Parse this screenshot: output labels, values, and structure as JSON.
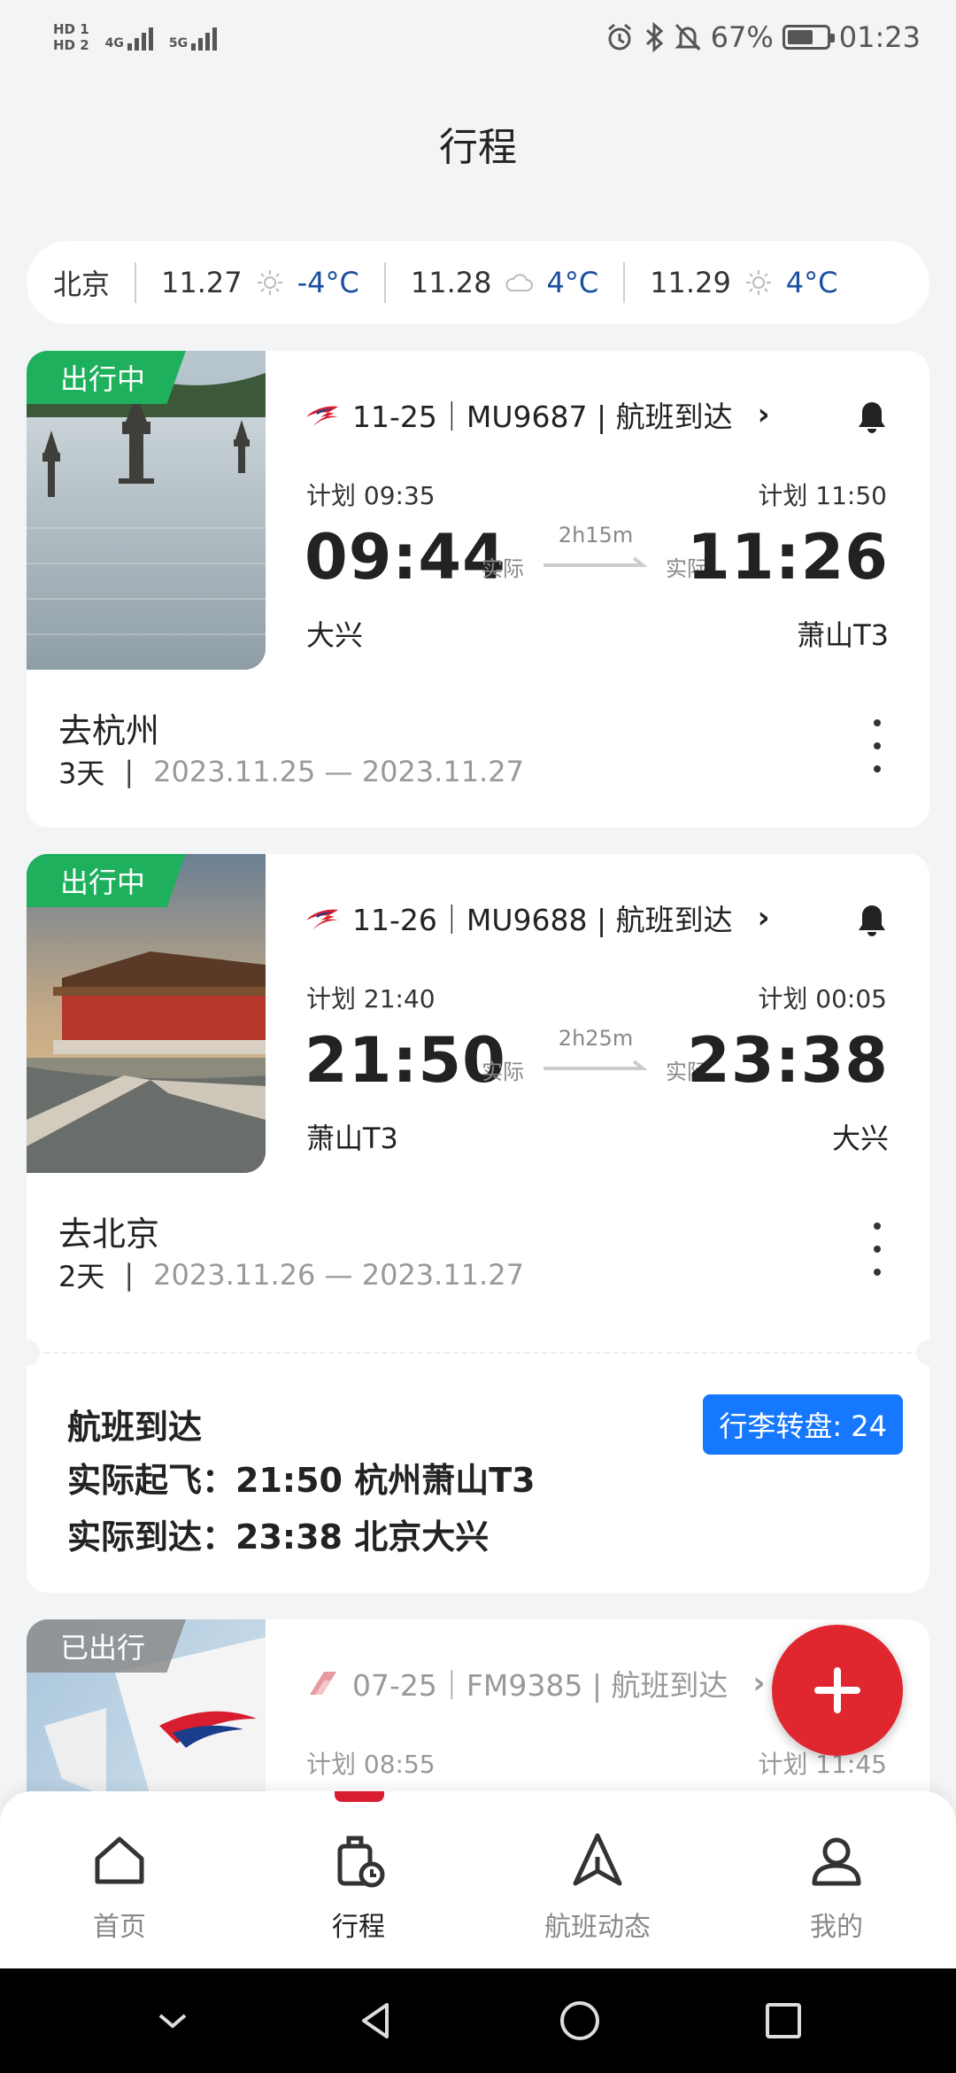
{
  "status": {
    "hd1": "HD 1",
    "hd2": "HD 2",
    "net1": "4G",
    "net2": "5G",
    "battery_pct": "67%",
    "battery_level": 0.67,
    "time": "01:23"
  },
  "page_title": "行程",
  "weather": {
    "city": "北京",
    "days": [
      {
        "date": "11.27",
        "icon": "sun-icon",
        "temp": "-4°C"
      },
      {
        "date": "11.28",
        "icon": "cloud-icon",
        "temp": "4°C"
      },
      {
        "date": "11.29",
        "icon": "sun-icon",
        "temp": "4°C"
      }
    ]
  },
  "trips": [
    {
      "badge": "出行中",
      "flight_line": "11-25｜MU9687 | 航班到达",
      "plan_dep": "计划 09:35",
      "plan_arr": "计划 11:50",
      "dep_time": "09:44",
      "arr_time": "11:26",
      "actual_label": "实际",
      "duration": "2h15m",
      "dep_airport": "大兴",
      "arr_airport": "萧山T3",
      "trip_name": "去杭州",
      "trip_days": "3天",
      "trip_sep": "|",
      "trip_dates": "2023.11.25 — 2023.11.27"
    },
    {
      "badge": "出行中",
      "flight_line": "11-26｜MU9688 | 航班到达",
      "plan_dep": "计划 21:40",
      "plan_arr": "计划 00:05",
      "dep_time": "21:50",
      "arr_time": "23:38",
      "actual_label": "实际",
      "duration": "2h25m",
      "dep_airport": "萧山T3",
      "arr_airport": "大兴",
      "trip_name": "去北京",
      "trip_days": "2天",
      "trip_sep": "|",
      "trip_dates": "2023.11.26 — 2023.11.27",
      "arrival": {
        "title": "航班到达",
        "dep_line": "实际起飞：21:50 杭州萧山T3",
        "arr_line": "实际到达：23:38 北京大兴",
        "baggage": "行李转盘: 24"
      }
    },
    {
      "badge": "已出行",
      "flight_line": "07-25｜FM9385 | 航班到达",
      "plan_dep": "计划 08:55",
      "plan_arr": "计划 11:45"
    }
  ],
  "tabs": [
    {
      "label": "首页",
      "icon": "home-icon"
    },
    {
      "label": "行程",
      "icon": "luggage-icon"
    },
    {
      "label": "航班动态",
      "icon": "plane-icon"
    },
    {
      "label": "我的",
      "icon": "user-icon"
    }
  ],
  "colors": {
    "accent": "#d81e2e",
    "in_progress": "#1eb05d",
    "baggage": "#1677ff",
    "fab": "#e0262f",
    "temp": "#1a4fa0"
  }
}
